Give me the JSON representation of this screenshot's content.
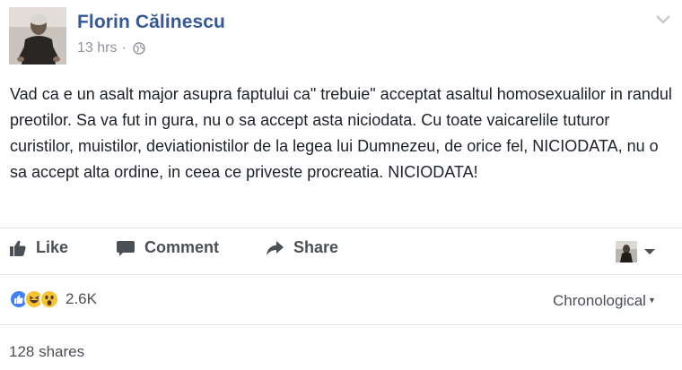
{
  "post": {
    "author": "Florin Călinescu",
    "time": "13 hrs",
    "separator": "·",
    "privacy_icon": "globe-icon",
    "menu_icon": "chevron-down-icon",
    "text": "Vad ca e un asalt major asupra faptului ca\" trebuie\" acceptat asaltul homosexualilor in randul preotilor. Sa va fut in gura, nu o sa accept asta niciodata. Cu toate vaicarelile tuturor curistilor, muistilor, deviationistilor de la legea lui Dumnezeu, de orice fel, NICIODATA, nu o sa accept alta ordine, in ceea ce priveste procreatia. NICIODATA!"
  },
  "actions": {
    "like_label": "Like",
    "comment_label": "Comment",
    "share_label": "Share"
  },
  "reactions": {
    "types": [
      "like",
      "haha",
      "wow"
    ],
    "count": "2.6K"
  },
  "sort": {
    "label": "Chronological"
  },
  "shares": {
    "label": "128 shares"
  },
  "colors": {
    "author_link": "#365899",
    "meta_gray": "#90949c",
    "action_gray": "#4b4f56",
    "like_blue": "#4080ff",
    "reaction_yellow": "#f7c531"
  }
}
